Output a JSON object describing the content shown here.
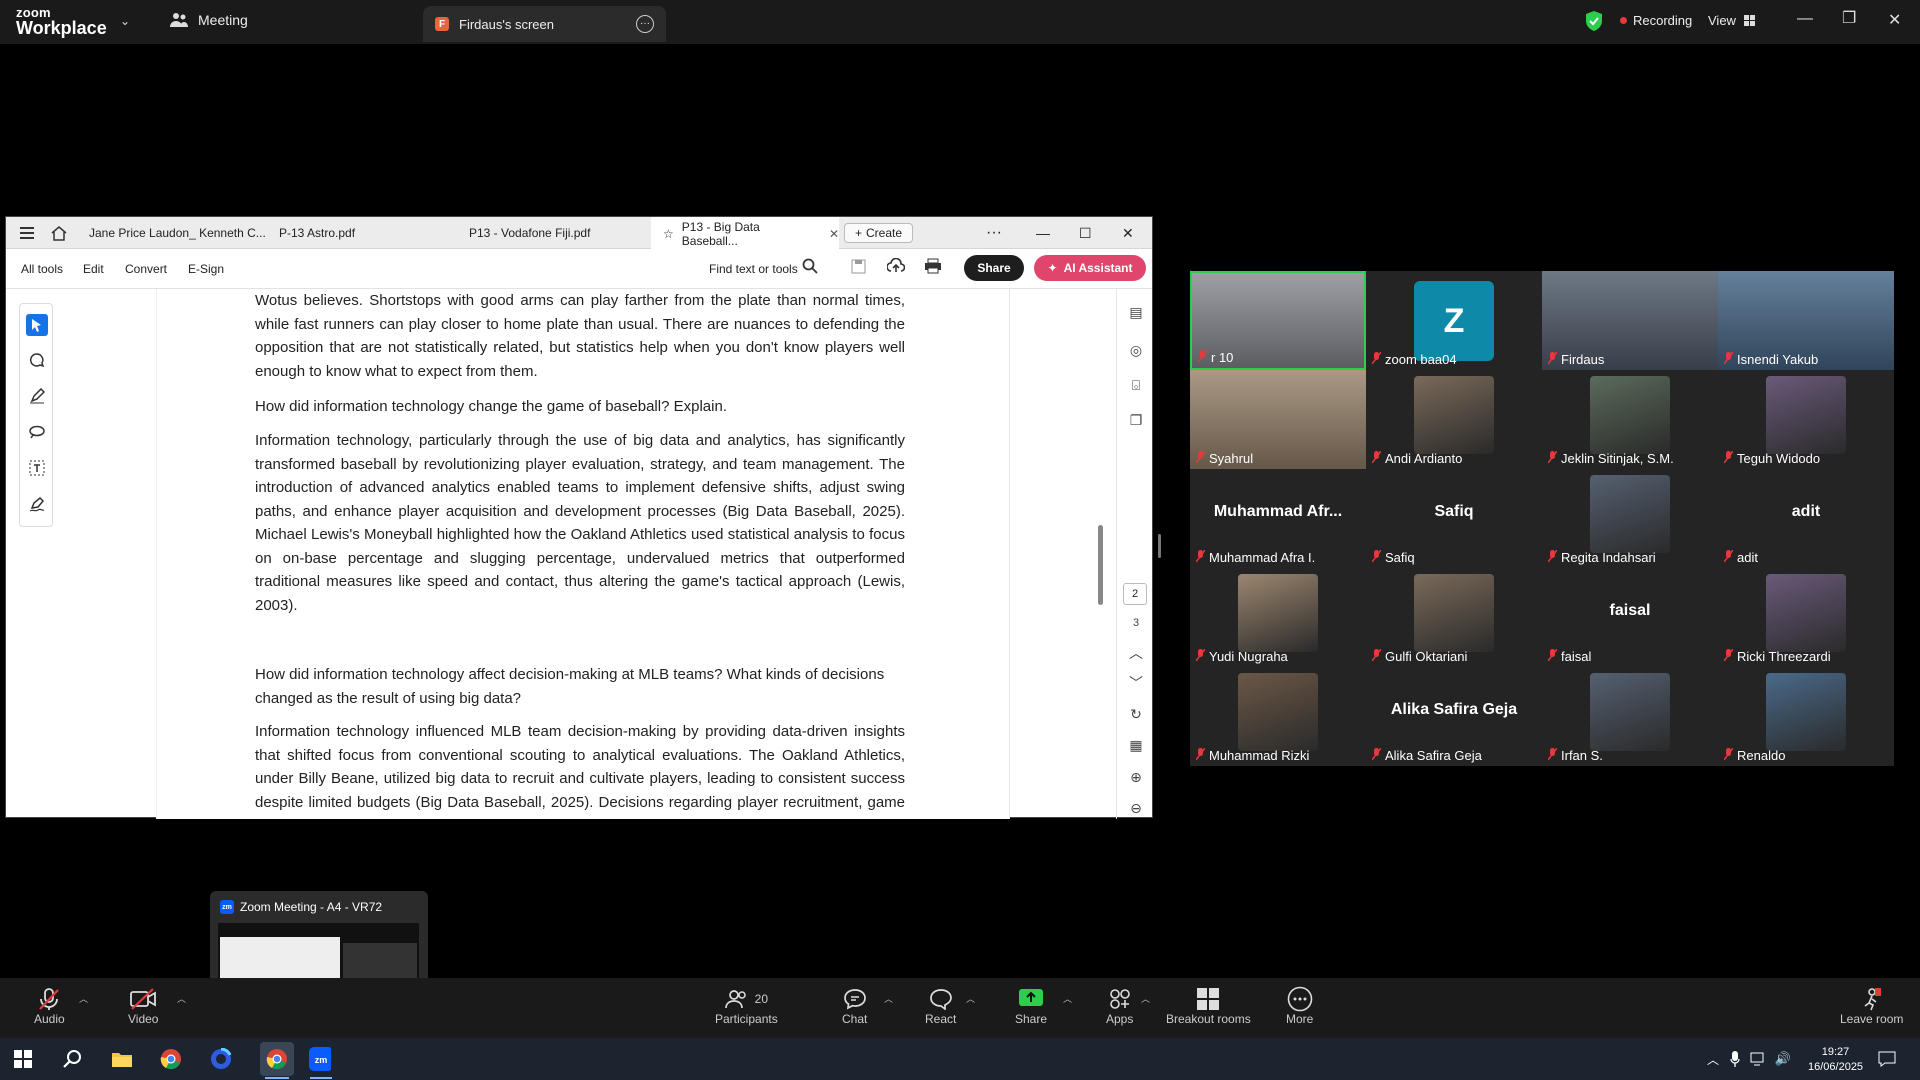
{
  "app": {
    "logo_line1": "zoom",
    "logo_line2": "Workplace",
    "meeting_tab": "Meeting",
    "screen_tab": "Firdaus's screen",
    "screen_badge": "F",
    "recording": "Recording",
    "view": "View"
  },
  "pdf": {
    "tabs": [
      "Jane Price Laudon_ Kenneth C...",
      "P-13 Astro.pdf",
      "P13 - Vodafone Fiji.pdf",
      "P13 - Big Data Baseball..."
    ],
    "create": "Create",
    "menu": [
      "All tools",
      "Edit",
      "Convert",
      "E-Sign"
    ],
    "find": "Find text or tools",
    "share": "Share",
    "ai_assistant": "AI Assistant",
    "page_current": "2",
    "page_next": "3",
    "paragraphs": [
      "Wotus believes. Shortstops with good arms can play farther from the plate than normal times, while fast runners can play closer to home plate than usual. There are nuances to defending the opposition that are not statistically related, but statistics help when you don't know players well enough to know what to expect from them.",
      "How did information technology change the game of baseball? Explain.",
      "Information technology, particularly through the use of big data and analytics, has significantly transformed baseball by revolutionizing player evaluation, strategy, and team management. The introduction of advanced analytics enabled teams to implement defensive shifts, adjust swing paths, and enhance player acquisition and development processes (Big Data Baseball, 2025). Michael Lewis's Moneyball highlighted how the Oakland Athletics used statistical analysis to focus on on-base percentage and slugging percentage, undervalued metrics that outperformed traditional measures like speed and contact, thus altering the game's tactical approach (Lewis, 2003).",
      "How did information technology affect decision-making at MLB teams? What kinds of decisions changed as the result of using big data?",
      "Information technology influenced MLB team decision-making by providing data-driven insights that shifted focus from conventional scouting to analytical evaluations. The Oakland Athletics, under Billy Beane, utilized big data to recruit and cultivate players, leading to consistent success despite limited budgets (Big Data Baseball, 2025). Decisions regarding player recruitment, game strategies (e.g., pitcher usage, batting orders), and overall roster management were guided by data"
    ]
  },
  "gallery": [
    {
      "name": "r 10",
      "big": "",
      "kind": "room"
    },
    {
      "name": "zoom baa04",
      "big": "",
      "kind": "z"
    },
    {
      "name": "Firdaus",
      "big": "",
      "kind": "photo"
    },
    {
      "name": "Isnendi Yakub",
      "big": "",
      "kind": "photo"
    },
    {
      "name": "Syahrul",
      "big": "",
      "kind": "photo"
    },
    {
      "name": "Andi Ardianto",
      "big": "",
      "kind": "photo"
    },
    {
      "name": "Jeklin Sitinjak, S.M.",
      "big": "",
      "kind": "photo"
    },
    {
      "name": "Teguh Widodo",
      "big": "",
      "kind": "photo"
    },
    {
      "name": "Muhammad Afra I.",
      "big": "Muhammad Afr...",
      "kind": "text"
    },
    {
      "name": "Safiq",
      "big": "Safiq",
      "kind": "text"
    },
    {
      "name": "Regita Indahsari",
      "big": "",
      "kind": "photo"
    },
    {
      "name": "adit",
      "big": "adit",
      "kind": "text"
    },
    {
      "name": "Yudi Nugraha",
      "big": "",
      "kind": "photo"
    },
    {
      "name": "Gulfi Oktariani",
      "big": "",
      "kind": "photo"
    },
    {
      "name": "faisal",
      "big": "faisal",
      "kind": "text"
    },
    {
      "name": "Ricki Threezardi",
      "big": "",
      "kind": "photo"
    },
    {
      "name": "Muhammad Rizki",
      "big": "",
      "kind": "photo"
    },
    {
      "name": "Alika Safira Geja",
      "big": "Alika Safira Geja",
      "kind": "text"
    },
    {
      "name": "Irfan S.",
      "big": "",
      "kind": "photo"
    },
    {
      "name": "Renaldo",
      "big": "",
      "kind": "photo"
    }
  ],
  "thumbnail": {
    "title": "Zoom Meeting - A4 - VR72",
    "badge": "zm"
  },
  "controls": {
    "audio": "Audio",
    "video": "Video",
    "participants": "Participants",
    "participants_count": "20",
    "chat": "Chat",
    "react": "React",
    "share": "Share",
    "apps": "Apps",
    "breakout": "Breakout rooms",
    "more": "More",
    "leave": "Leave room"
  },
  "taskbar": {
    "time": "19:27",
    "date": "16/06/2025"
  },
  "colors": {
    "accent_green": "#2dce4b",
    "recording_red": "#e5393a",
    "ai_pink": "#e0466b",
    "zoom_blue": "#0b5cff"
  }
}
